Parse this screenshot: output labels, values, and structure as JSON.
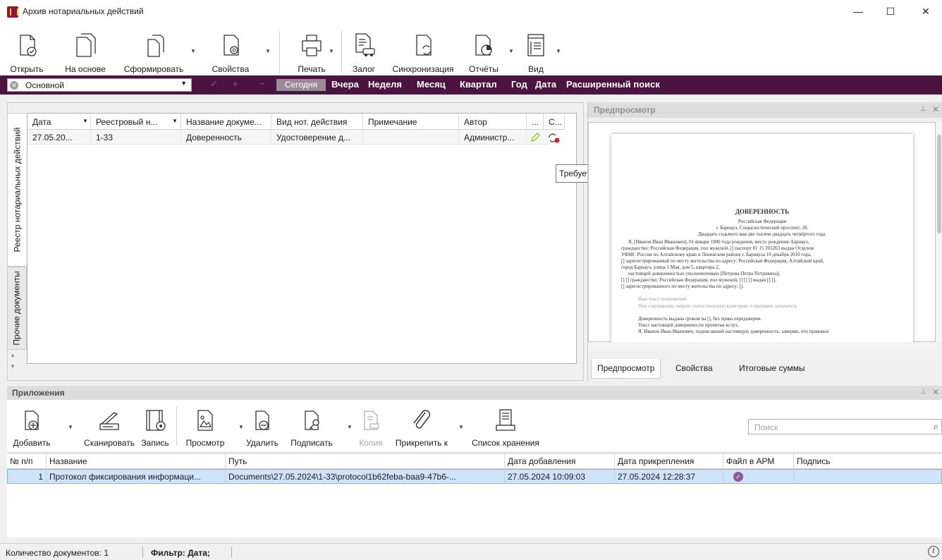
{
  "window": {
    "title": "Архив нотариальных действий",
    "minimize": "—",
    "maximize": "☐",
    "close": "✕"
  },
  "toolbar": {
    "open": "Открыть",
    "based_on": "На основе",
    "form": "Сформировать",
    "properties": "Свойства",
    "print": "Печать",
    "pledge": "Залог",
    "sync": "Синхронизация",
    "reports": "Отчёты",
    "view": "Вид"
  },
  "filterbar": {
    "scheme": "Основной",
    "ok": "✓",
    "plus": "+",
    "minus": "−",
    "today": "Сегодня",
    "yesterday": "Вчера",
    "week": "Неделя",
    "month": "Месяц",
    "quarter": "Квартал",
    "year": "Год",
    "date": "Дата",
    "advanced": "Расширенный поиск"
  },
  "side_tabs": {
    "registry": "Реестр нотариальных действий",
    "other": "Прочие документы"
  },
  "registry": {
    "columns": [
      "Дата",
      "Реестровый н...",
      "Название докуме...",
      "Вид нот. действия",
      "Примечание",
      "Автор",
      "...",
      "С..."
    ],
    "rows": [
      {
        "date": "27.05.20...",
        "reg_no": "1-33",
        "doc_name": "Доверенность",
        "action_type": "Удостоверение д...",
        "note": "",
        "author": "Администр..."
      }
    ],
    "tooltip": "Требуется синхронизация документа"
  },
  "preview": {
    "title": "Предпросмотр",
    "tabs": [
      "Предпросмотр",
      "Свойства",
      "Итоговые суммы"
    ],
    "doc": {
      "heading": "ДОВЕРЕННОСТЬ",
      "l1": "Российская Федерация",
      "l2": "г. Барнаул, Социалистический проспект, 28.",
      "l3": "Двадцать седьмого мая две тысячи двадцать четвёртого года.",
      "l4": "Я, [Иванов Иван Иванович], 01 января 1900 года рождения, место рождения: Барнаул,",
      "l5": "гражданство: Российская Федерация, пол мужской, [] паспорт 01 15 203263 выдан Отделом",
      "l6": "УФМС России по Алтайскому краю в Ленинском районе г. Барнаула 10 декабря 2010 года,",
      "l7": "[] зарегистрированный по месту жительства по адресу: Российская Федерация, Алтайский край,",
      "l8": "город Барнаул, улица 1 Мая, дом 5, квартира 2,",
      "l9": "настоящей доверенностью уполномочиваю [Петрова Петра Петровича],",
      "l10": "[] [] гражданство: Российская Федерация, пол мужской, [] [] [] выдан [] [],",
      "l11": "[] зарегистрированного по месту жительства по адресу: [].",
      "l12": "Ваш текст полномочий.",
      "l13": "При сокращении сверьте статистическую категорию и признаки документа",
      "l14": "Доверенность выдана сроком на [], без права передоверия.",
      "l15": "Текст настоящей доверенности прочитан вслух.",
      "l16": "Я, Иванов Иван Иванович, подписавший настоящую доверенность, заверяю, что правовые"
    }
  },
  "attachments": {
    "title": "Приложения",
    "toolbar": {
      "add": "Добавить",
      "scan": "Сканировать",
      "record": "Запись",
      "view": "Просмотр",
      "delete": "Удалить",
      "sign": "Подписать",
      "copy": "Копия",
      "attach_to": "Прикрепить к",
      "storage_list": "Список хранения"
    },
    "search_placeholder": "Поиск",
    "columns": [
      "№ п/п",
      "Название",
      "Путь",
      "Дата добавления",
      "Дата прикрепления",
      "Файл в АРМ",
      "Подпись"
    ],
    "rows": [
      {
        "num": "1",
        "name": "Протокол фиксирования информаци...",
        "path": "Documents\\27.05.2024\\1-33\\protocol1b62feba-baa9-47b6-...",
        "added": "27.05.2024 10:09:03",
        "attached": "27.05.2024 12:28:37",
        "in_arm": true,
        "signature": ""
      }
    ]
  },
  "status": {
    "count": "Количество документов: 1",
    "filter": "Фильтр: Дата;"
  },
  "colors": {
    "accent": "#4b1340",
    "selection": "#cfe3fb",
    "check": "#8a5c9a",
    "pencil": "#9ccc3c",
    "sync_red": "#d0202a"
  }
}
